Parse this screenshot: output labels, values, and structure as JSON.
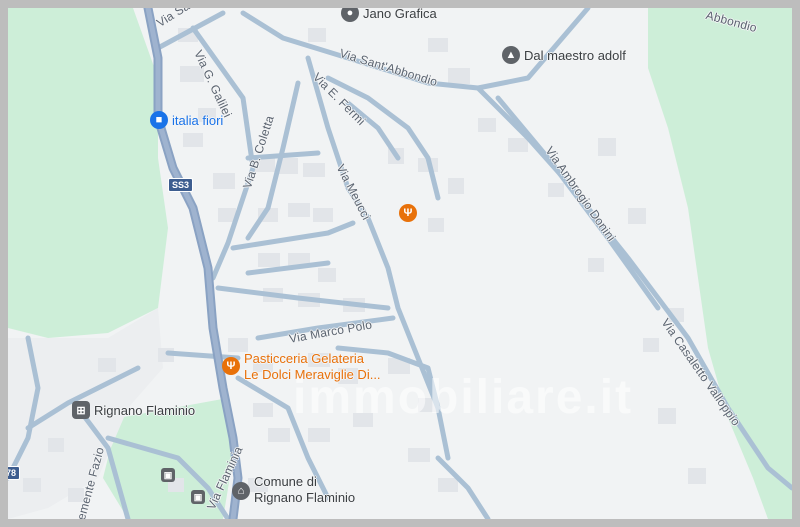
{
  "colors": {
    "background": "#f1f3f4",
    "park": "#cdeed8",
    "road": "#aac0d4",
    "highway": "#8aa2c3",
    "building": "#e3e6ea",
    "poi_blue": "#1a73e8",
    "poi_orange": "#e8710a",
    "poi_gray": "#5f6368",
    "poi_text_blue": "#1a73e8",
    "poi_text_orange": "#e8710a",
    "poi_text_gray": "#3c4043"
  },
  "streets": {
    "via_santabbondio_top": "Via Sant'Ab",
    "via_g_galilei": "Via G. Galilei",
    "via_santabbondio": "Via Sant'Abbondio",
    "via_e_fermi": "Via E. Fermi",
    "via_b_coletta": "Via B. Coletta",
    "via_meucci": "Via Meucci",
    "via_ambrogio_donini": "Via Ambrogio Donini",
    "via_marco_polo": "Via Marco Polo",
    "via_casaletto_valloppio": "Via Casaletto Valloppio",
    "via_flaminia": "Via Flaminia",
    "clemente_fazio": "emente Fazio",
    "abbondio_corner": "Abbondio",
    "shield_ss3": "SS3",
    "shield_78": "78"
  },
  "pois": {
    "jano_grafica": {
      "label": "Jano Grafica",
      "icon": "map-pin-icon"
    },
    "dal_maestro": {
      "label": "Dal maestro adolf",
      "icon": "school-icon"
    },
    "italia_fiori": {
      "label": "italia fiori",
      "icon": "shopping-bag-icon"
    },
    "restaurant": {
      "icon": "fork-knife-icon"
    },
    "pasticceria_line1": "Pasticceria Gelateria",
    "pasticceria_line2": "Le Dolci Meraviglie Di...",
    "pasticceria_icon": "fork-knife-icon",
    "rignano_station": {
      "label": "Rignano Flaminio",
      "icon": "train-icon"
    },
    "comune_line1": "Comune di",
    "comune_line2": "Rignano Flaminio",
    "comune_icon": "town-hall-icon"
  },
  "watermark": "immobiliare.it"
}
